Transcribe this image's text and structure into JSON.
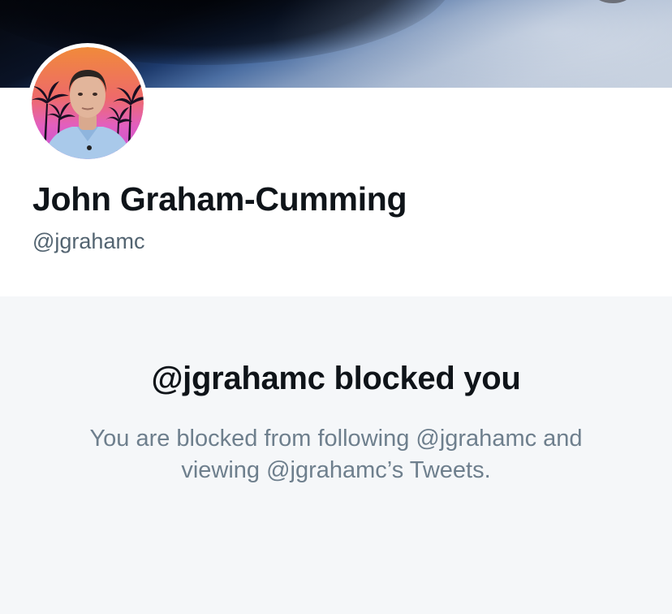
{
  "profile": {
    "display_name": "John Graham-Cumming",
    "handle": "@jgrahamc"
  },
  "blocked": {
    "title": "@jgrahamc blocked you",
    "message": "You are blocked from following @jgrahamc and viewing @jgrahamc’s Tweets."
  },
  "colors": {
    "text_primary": "#0f1419",
    "text_secondary": "#536471",
    "panel_background": "#f5f7f9"
  }
}
